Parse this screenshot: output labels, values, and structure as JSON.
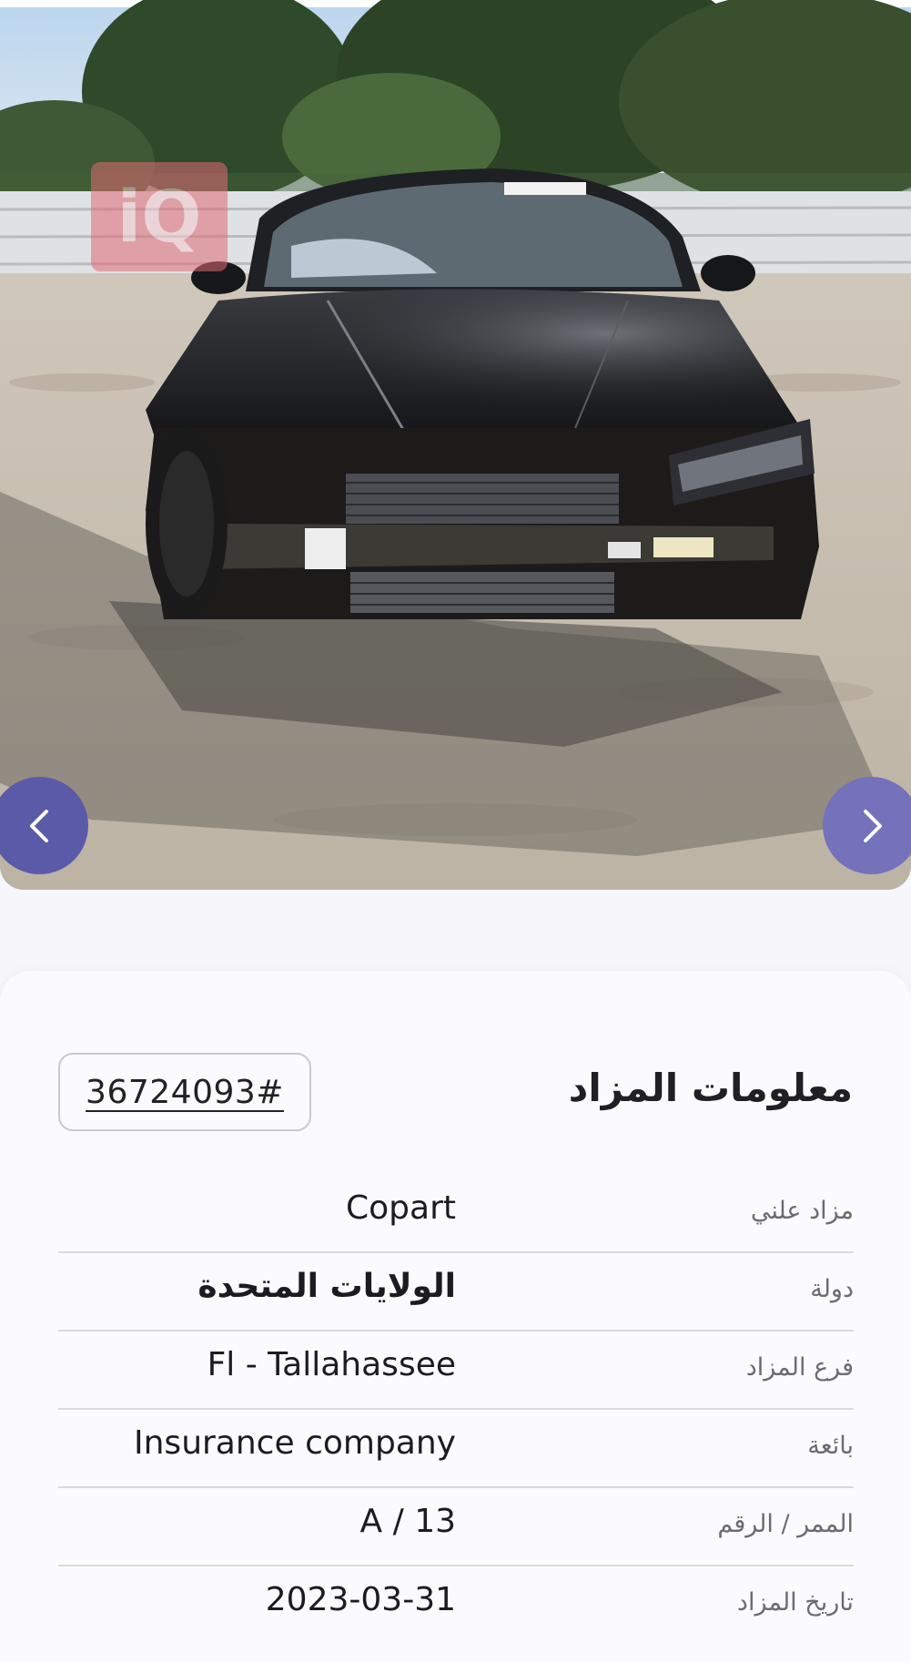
{
  "gallery": {
    "image_alt": "Damaged black sedan, front view, at auction yard",
    "watermark_text": "iQ",
    "prev_icon": "chevron-left-icon",
    "next_icon": "chevron-right-icon",
    "colors": {
      "prev_button": "#5b5aa8",
      "next_button": "#7372bb"
    }
  },
  "auction_info": {
    "title": "معلومات المزاد",
    "lot_number": "36724093#",
    "rows": [
      {
        "label": "مزاد علني",
        "value": "Copart"
      },
      {
        "label": "دولة",
        "value": "الولايات المتحدة"
      },
      {
        "label": "فرع المزاد",
        "value": "Fl - Tallahassee"
      },
      {
        "label": "بائعة",
        "value": "Insurance company"
      },
      {
        "label": "الممر / الرقم",
        "value": "A / 13"
      },
      {
        "label": "تاريخ المزاد",
        "value": "2023-03-31"
      }
    ]
  }
}
